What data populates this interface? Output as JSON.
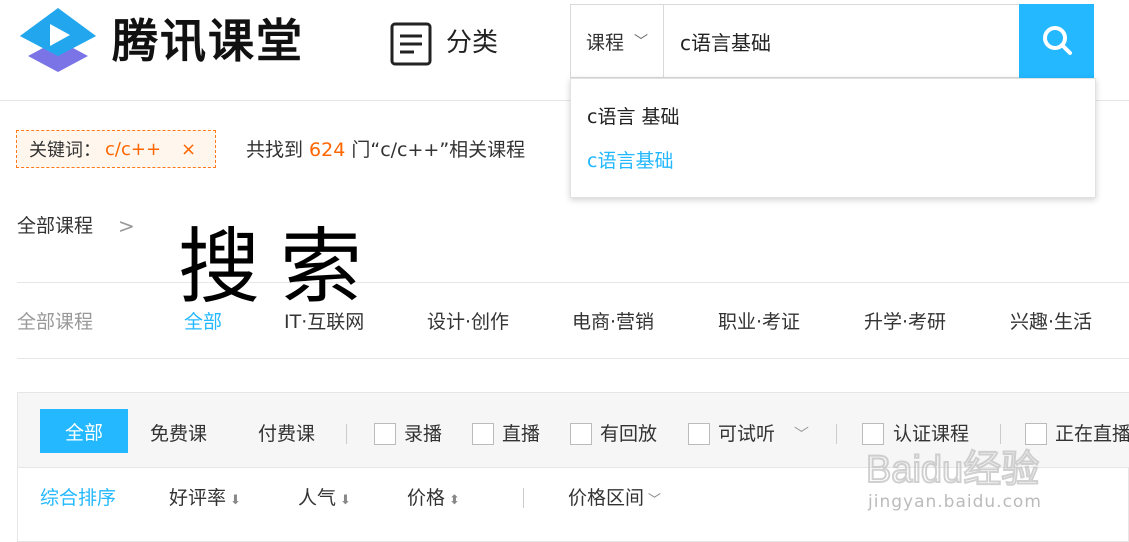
{
  "brand": {
    "name": "腾讯课堂",
    "accent_color": "#23b8ff"
  },
  "header": {
    "category_label": "分类",
    "search": {
      "type_label": "课程",
      "value": "c语言基础",
      "button_icon": "search-icon"
    }
  },
  "suggestions": [
    "c语言 基础",
    "c语言基础"
  ],
  "keyword": {
    "label": "关键词：",
    "value": "c/c++",
    "close": "×"
  },
  "result_summary": {
    "prefix": "共找到 ",
    "count": "624",
    "middle": " 门“c/c++”相关课程"
  },
  "breadcrumb": {
    "label": "全部课程"
  },
  "overlay_text": "搜索",
  "category_nav": {
    "label": "全部课程",
    "items": [
      "全部",
      "IT·互联网",
      "设计·创作",
      "电商·营销",
      "职业·考证",
      "升学·考研",
      "兴趣·生活"
    ],
    "active_color": "#23b8ff"
  },
  "filters": {
    "all_label": "全部",
    "price_types": [
      "免费课",
      "付费课"
    ],
    "checkboxes": [
      "录播",
      "直播",
      "有回放",
      "可试听",
      "认证课程",
      "正在直播"
    ]
  },
  "sort": {
    "items": [
      "综合排序",
      "好评率",
      "人气",
      "价格"
    ],
    "price_range_label": "价格区间"
  },
  "watermark": {
    "logo_text": "Baidu经验",
    "url": "jingyan.baidu.com"
  }
}
